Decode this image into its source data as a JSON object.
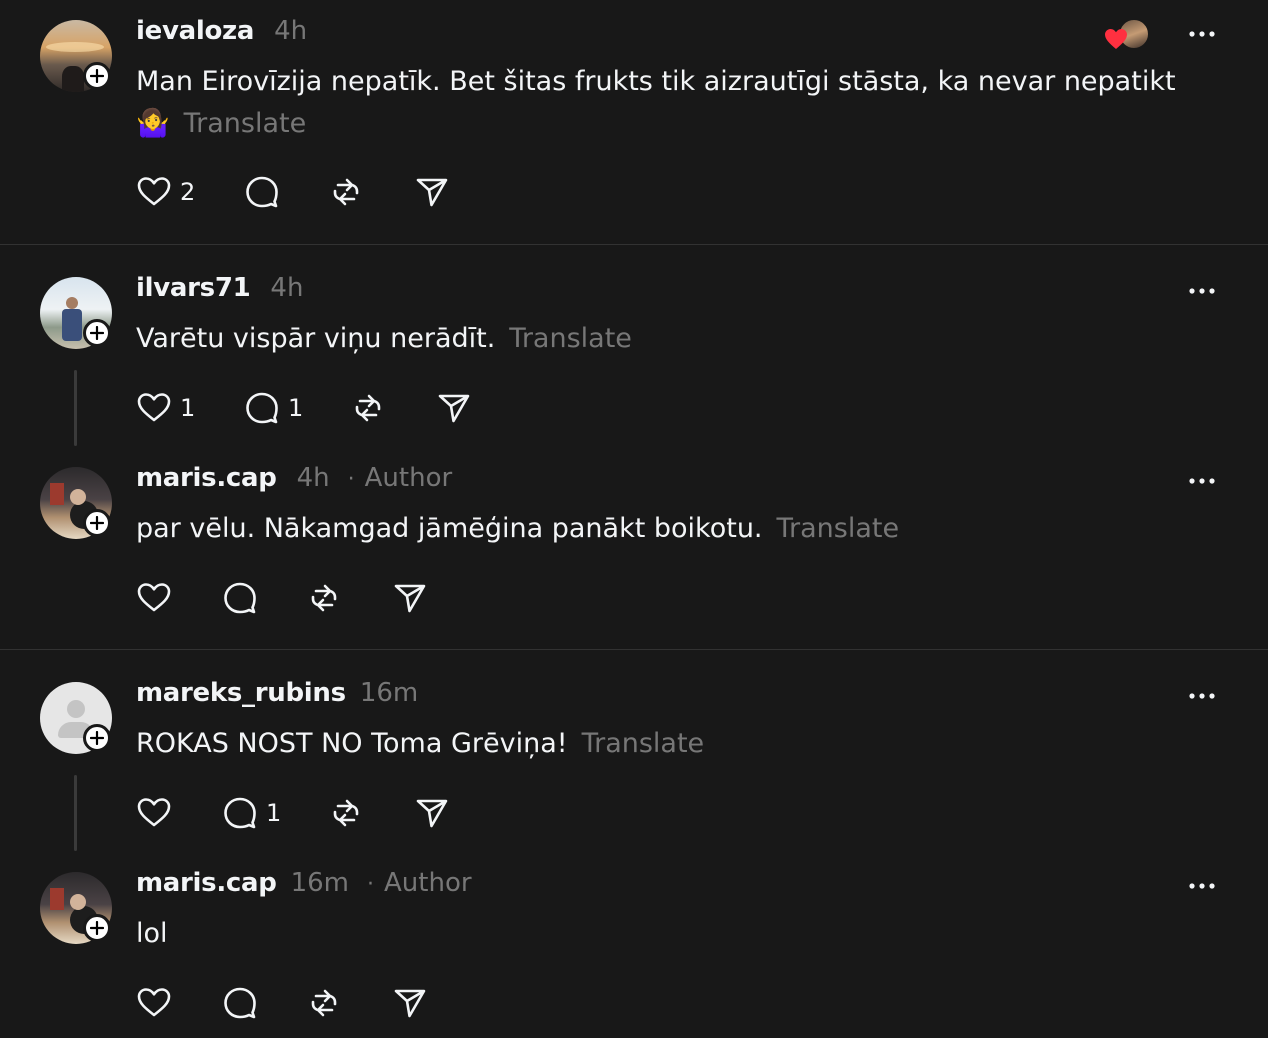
{
  "colors": {
    "background": "#181818",
    "text_primary": "#f3f5f7",
    "text_secondary": "#777777",
    "divider": "#323232",
    "like_red": "#ff3040"
  },
  "posts": [
    {
      "username": "ievaloza",
      "time": "4h",
      "text": "Man Eirovīzija nepatīk. Bet šitas frukts tik aizrautīgi stāsta, ka nevar nepatikt",
      "text_line2_emoji": "🤷‍♀️",
      "translate": "Translate",
      "likes": "2",
      "replies": "",
      "avatar_icon": "sunset-photo-avatar",
      "reactors_icon": "heart-reaction-icon"
    },
    {
      "username": "ilvars71",
      "time": "4h",
      "text": "Varētu vispār viņu nerādīt.",
      "translate": "Translate",
      "likes": "1",
      "replies": "1",
      "avatar_icon": "beach-photo-avatar"
    },
    {
      "username": "maris.cap",
      "time": "4h",
      "author_label": "Author",
      "separator": "·",
      "text": "par vēlu. Nākamgad jāmēģina panākt boikotu.",
      "translate": "Translate",
      "likes": "",
      "replies": "",
      "avatar_icon": "office-photo-avatar"
    },
    {
      "username": "mareks_rubins",
      "time": "16m",
      "text": "ROKAS NOST NO Toma Grēviņa!",
      "translate": "Translate",
      "likes": "",
      "replies": "1",
      "avatar_icon": "default-user-avatar"
    },
    {
      "username": "maris.cap",
      "time": "16m",
      "author_label": "Author",
      "separator": "·",
      "text": "lol",
      "likes": "",
      "replies": "",
      "avatar_icon": "office-photo-avatar"
    }
  ]
}
